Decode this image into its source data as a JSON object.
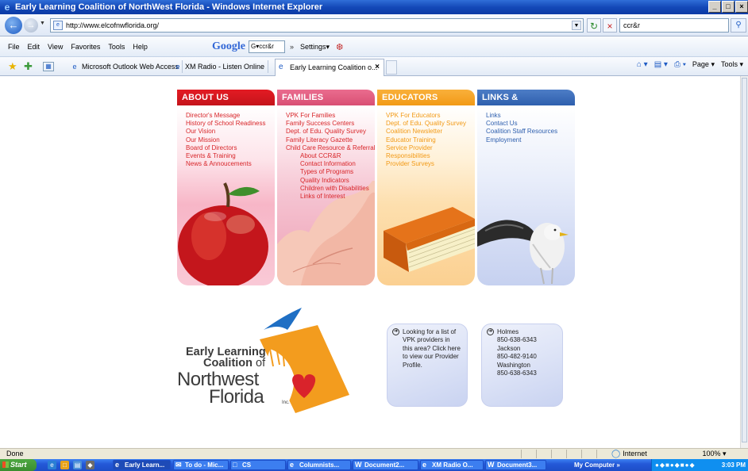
{
  "window": {
    "title": "Early Learning Coalition of NorthWest Florida - Windows Internet Explorer",
    "controls": [
      "_",
      "□",
      "×"
    ]
  },
  "address": {
    "url": "http://www.elcofnwflorida.org/",
    "search_value": "ccr&r"
  },
  "menu": {
    "items": [
      "File",
      "Edit",
      "View",
      "Favorites",
      "Tools",
      "Help"
    ],
    "google_logo": "Google",
    "google_input": "G▾ccr&r",
    "google_extra": "»",
    "settings": "Settings▾"
  },
  "favorites": {
    "links": [
      {
        "label": "Microsoft Outlook Web Access"
      },
      {
        "label": "XM Radio - Listen Online"
      }
    ],
    "active_tab": "Early Learning Coalition o...",
    "commands": [
      "Page ▾",
      "Tools ▾"
    ]
  },
  "columns": {
    "about": {
      "header": "ABOUT US",
      "links": [
        "Director's Message",
        "History of School Readiness",
        "Our Vision",
        "Our Mission",
        "Board of Directors",
        "Events & Training",
        "News & Annoucements"
      ]
    },
    "families": {
      "header": "FAMILIES",
      "links": [
        "VPK For Families",
        "Family Success Centers",
        "Dept. of Edu. Quality Survey",
        "Family Literacy Gazette",
        "Child Care Resource & Referral"
      ],
      "sublinks": [
        "About CCR&R",
        "Contact Information",
        "Types of Programs",
        "Quality Indicators",
        "Children with Disabilities",
        "Links of Interest"
      ]
    },
    "educators": {
      "header": "EDUCATORS",
      "links": [
        "VPK For Educators",
        "Dept. of Edu. Quality Survey",
        "Coalition Newsletter",
        "Educator Training",
        "Service Provider",
        "Responsibilities",
        "Provider Surveys"
      ]
    },
    "resources": {
      "header": "LINKS & RESOURCES",
      "links": [
        "Links",
        "Contact Us",
        "Coalition Staff Resources",
        "Employment"
      ]
    }
  },
  "logo": {
    "line1": "Early Learning",
    "line2": "Coalition",
    "line2_of": " of",
    "line3": "Northwest",
    "line4": "Florida",
    "inc": "Inc."
  },
  "vpk_box": {
    "lines": [
      "Looking for a list of",
      "VPK providers in",
      "this area? Click here",
      "to view our Provider",
      "Profile."
    ]
  },
  "counties_box": {
    "lines": [
      "Holmes",
      "850-638-6343",
      "Jackson",
      "850-482-9140",
      "Washington",
      "850-638-6343"
    ]
  },
  "status": {
    "text": "Done",
    "zone": "Internet",
    "zoom": " 100% ▾"
  },
  "taskbar": {
    "start": "Start",
    "tasks": [
      "Early Learn...",
      "To do - Mic...",
      "CS",
      "Columnists...",
      "Document2...",
      "XM Radio O...",
      "Document3..."
    ],
    "my_computer": "My Computer »",
    "clock": "3:03 PM"
  }
}
